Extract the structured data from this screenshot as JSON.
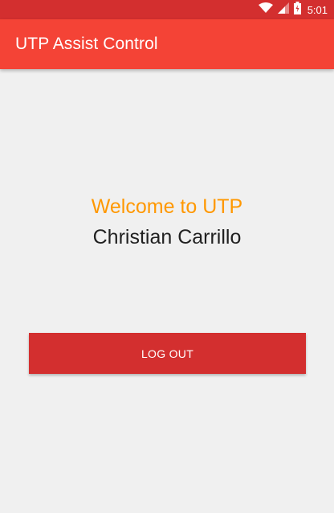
{
  "status_bar": {
    "time": "5:01",
    "background_color": "#d32f2f",
    "icons": [
      "wifi-icon",
      "signal-icon",
      "battery-icon"
    ]
  },
  "app_bar": {
    "title": "UTP Assist Control",
    "background_color": "#f44336"
  },
  "main": {
    "welcome_text": "Welcome to UTP",
    "welcome_color": "#ff9800",
    "user_name": "Christian Carrillo",
    "logout_label": "LOG OUT",
    "logout_color": "#d32f2f"
  }
}
